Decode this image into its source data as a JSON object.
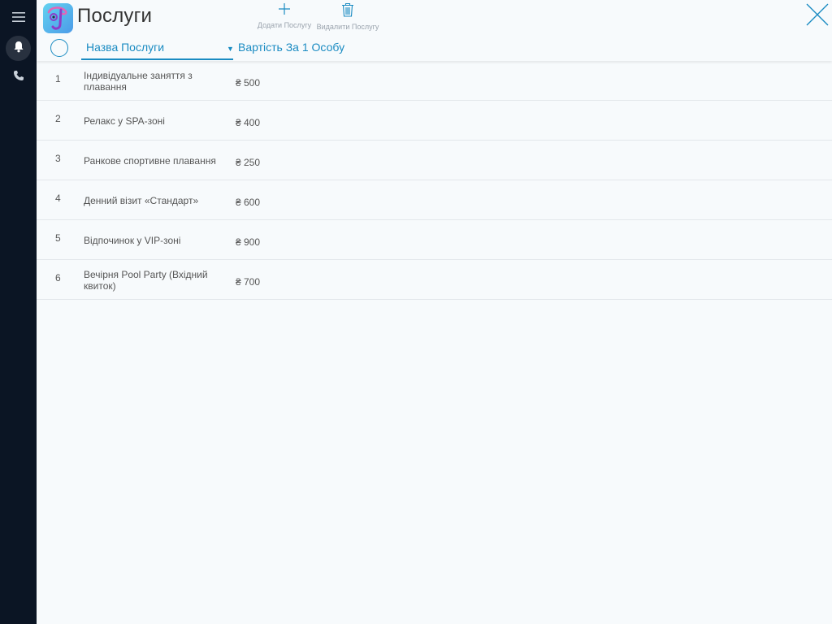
{
  "header": {
    "title": "Послуги",
    "add_label": "Додати Послугу",
    "delete_label": "Видалити Послугу"
  },
  "columns": {
    "name": "Назва Послуги",
    "sort_indicator": "▼",
    "price": "Вартість За 1 Особу"
  },
  "rows": [
    {
      "num": "1",
      "name": "Індивідуальне заняття з плавання",
      "price": "₴ 500"
    },
    {
      "num": "2",
      "name": "Релакс у SPA-зоні",
      "price": "₴ 400"
    },
    {
      "num": "3",
      "name": "Ранкове спортивне плавання",
      "price": "₴ 250"
    },
    {
      "num": "4",
      "name": "Денний візит «Стандарт»",
      "price": "₴ 600"
    },
    {
      "num": "5",
      "name": "Відпочинок у VIP-зоні",
      "price": "₴ 900"
    },
    {
      "num": "6",
      "name": "Вечірня Pool Party (Вхідний квиток)",
      "price": "₴ 700"
    }
  ],
  "icons": {
    "menu": "menu-icon",
    "notifications": "bell-icon",
    "calls": "phone-icon",
    "add": "plus-icon",
    "delete": "trash-icon",
    "close": "close-icon"
  },
  "colors": {
    "sidebar": "#0b1524",
    "accent": "#1a8bc2",
    "background": "#f7fafc"
  }
}
